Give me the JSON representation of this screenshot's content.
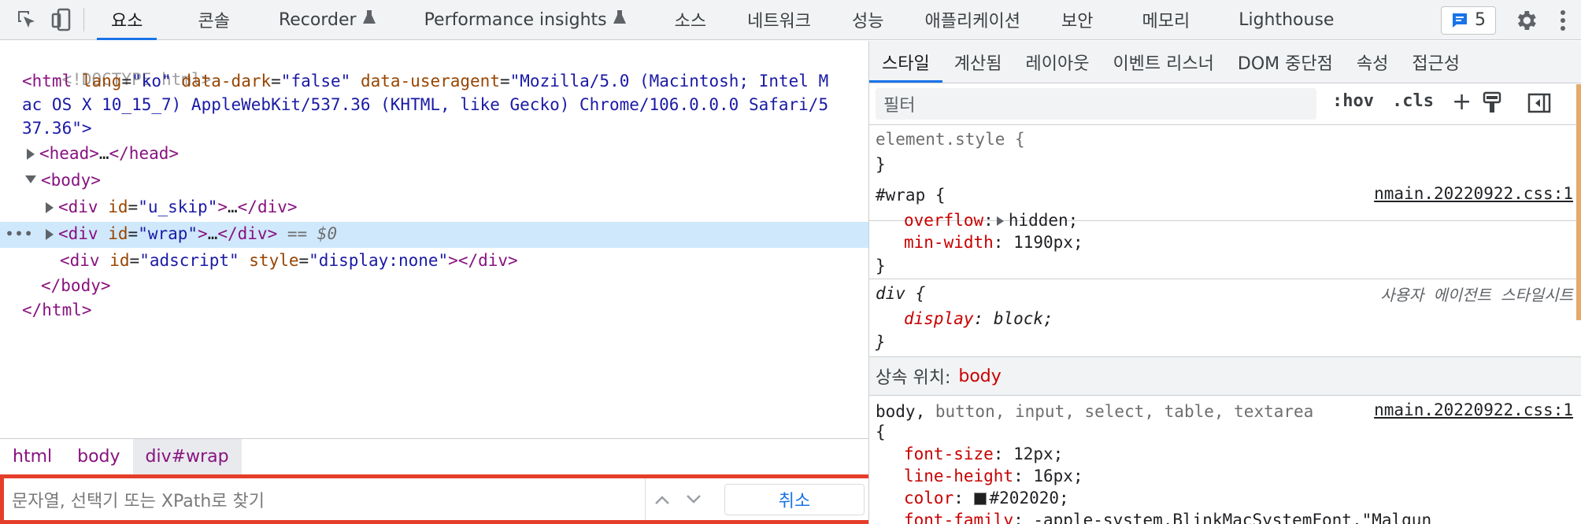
{
  "toolbar": {
    "tabs": [
      {
        "label": "요소",
        "flask": false
      },
      {
        "label": "콘솔",
        "flask": false
      },
      {
        "label": "Recorder",
        "flask": true
      },
      {
        "label": "Performance insights",
        "flask": true
      },
      {
        "label": "소스",
        "flask": false
      },
      {
        "label": "네트워크",
        "flask": false
      },
      {
        "label": "성능",
        "flask": false
      },
      {
        "label": "애플리케이션",
        "flask": false
      },
      {
        "label": "보안",
        "flask": false
      },
      {
        "label": "메모리",
        "flask": false
      },
      {
        "label": "Lighthouse",
        "flask": false
      }
    ],
    "issues_count": "5",
    "accent": "#1a73e8"
  },
  "dom": {
    "doctype": "<!DOCTYPE html>",
    "html_open_1": "ac OS X 10_15_7) AppleWebKit/537.36 (KHTML, like Gecko) Chrome/106.0.0.0 Safari/5",
    "html_open_2": "37.36\">",
    "html_lang_val": "\"ko\"",
    "html_dark_val": "\"false\"",
    "html_ua_val_start": "\"Mozilla/5.0 (Macintosh; Intel M",
    "head": "…",
    "div1_id": "\"u_skip\"",
    "div2_id": "\"wrap\"",
    "selected_marker": "== $0",
    "div3_id": "\"adscript\"",
    "div3_style": "\"display:none\""
  },
  "breadcrumbs": [
    "html",
    "body",
    "div#wrap"
  ],
  "search": {
    "placeholder": "문자열, 선택기 또는 XPath로 찾기",
    "cancel_label": "취소",
    "highlight_color": "#e53e2b"
  },
  "styles": {
    "tabs": [
      "스타일",
      "계산됨",
      "레이아웃",
      "이벤트 리스너",
      "DOM 중단점",
      "속성",
      "접근성"
    ],
    "filter_placeholder": "필터",
    "hov": ":hov",
    "cls": ".cls",
    "element_style": "element.style {",
    "close_brace": "}",
    "wrap_selector": "#wrap {",
    "wrap_source": "nmain.20220922.css:1",
    "wrap_overflow_prop": "overflow",
    "wrap_overflow_val": "hidden;",
    "wrap_minwidth_prop": "min-width",
    "wrap_minwidth_val": "1190px;",
    "div_selector": "div {",
    "ua_label": "사용자 에이전트 스타일시트",
    "div_display_prop": "display",
    "div_display_val": "block;",
    "inherit_label": "상속 위치:",
    "inherit_tag": "body",
    "body_selector_main": "body,",
    "body_selector_rest": " button, input, select, table, textarea",
    "body_source": "nmain.20220922.css:1",
    "open_brace": "{",
    "body_fontsize_prop": "font-size",
    "body_fontsize_val": "12px;",
    "body_lineheight_prop": "line-height",
    "body_lineheight_val": "16px;",
    "body_color_prop": "color",
    "body_color_val": "#202020;",
    "body_fontfamily_prop": "font-family",
    "body_fontfamily_val": "-apple-system,BlinkMacSystemFont,\"Malgun"
  }
}
